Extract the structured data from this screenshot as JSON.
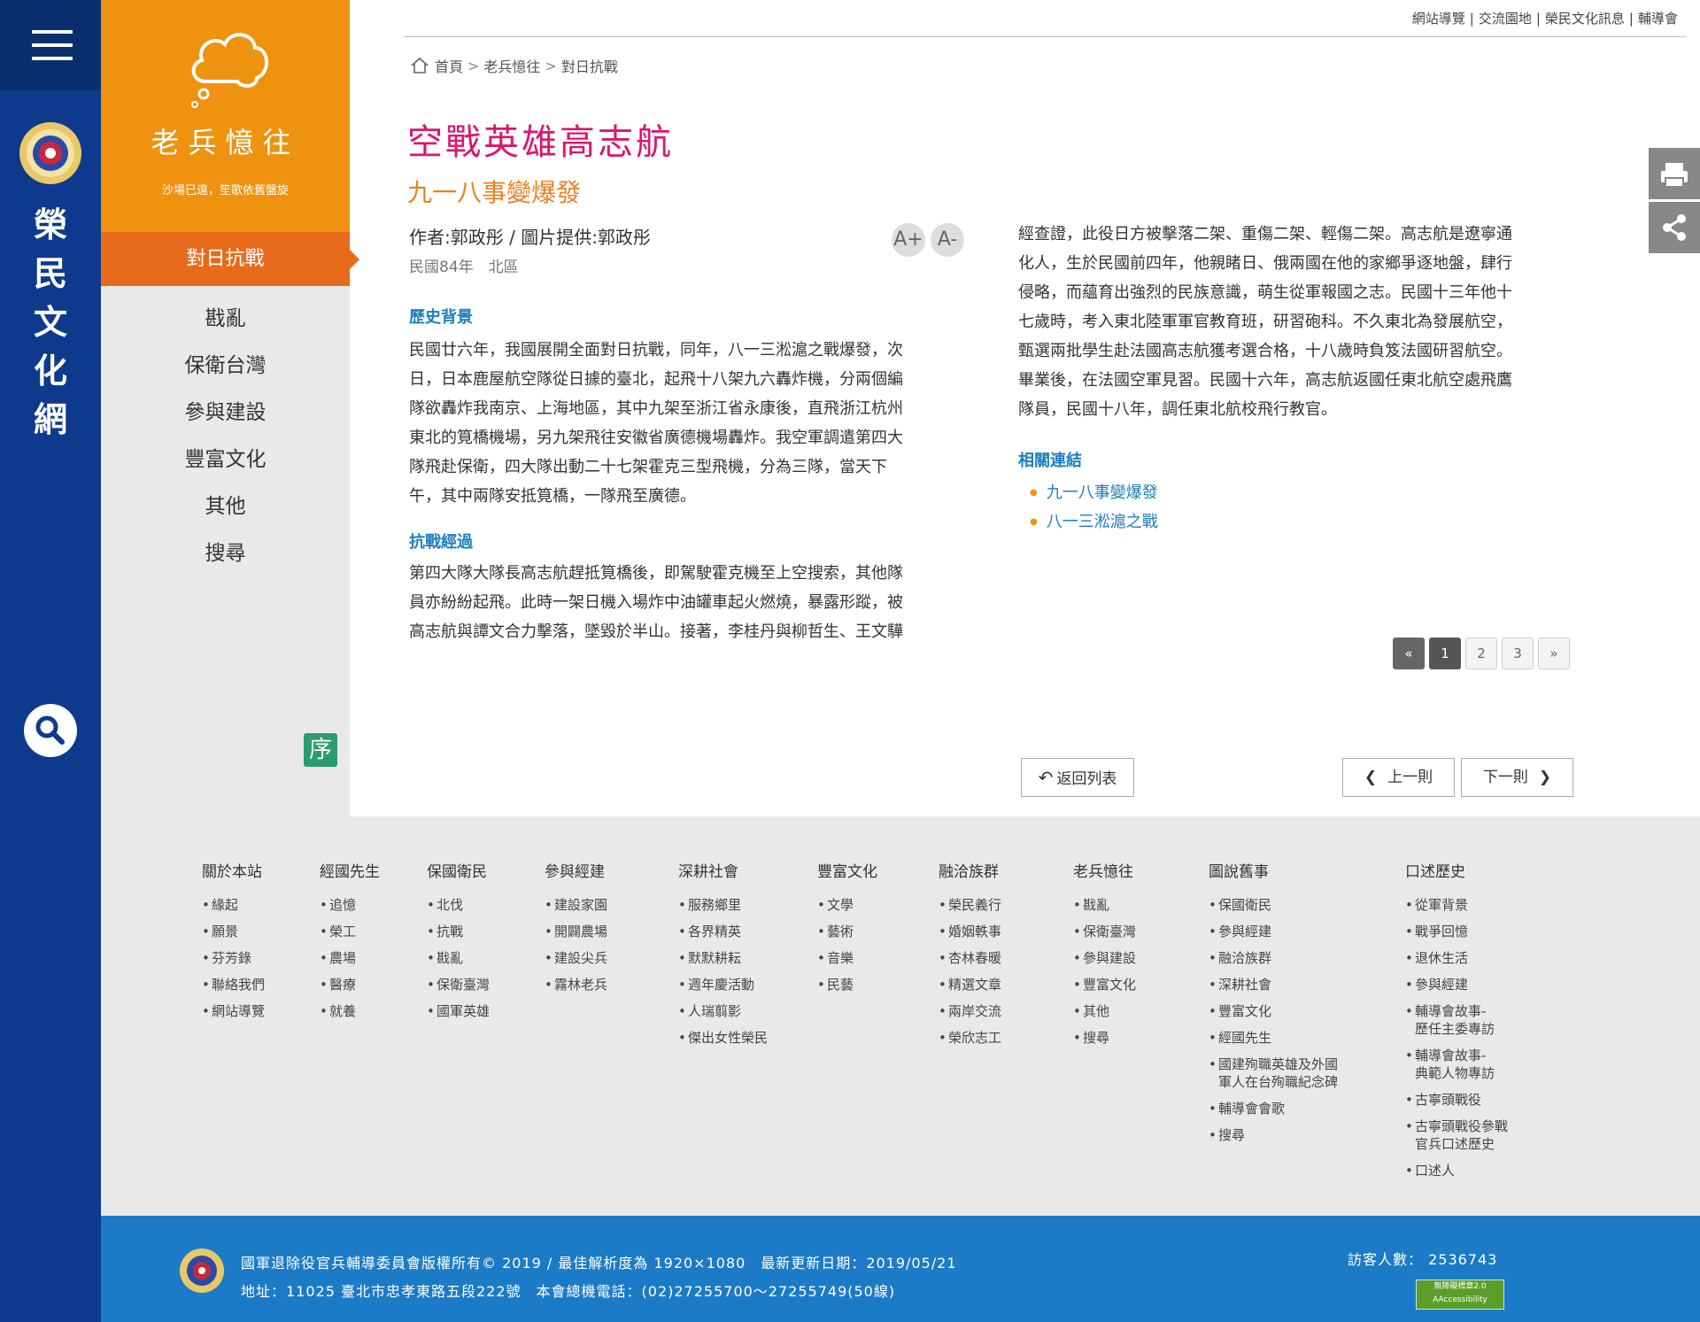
{
  "site": {
    "name_chars": [
      "榮",
      "民",
      "文",
      "化",
      "網"
    ],
    "search_icon": "magnifier-icon"
  },
  "top_links": [
    "網站導覽",
    "交流園地",
    "榮民文化訊息",
    "輔導會"
  ],
  "breadcrumb": [
    "首頁",
    "老兵憶往",
    "對日抗戰"
  ],
  "section": {
    "title": "老兵憶往",
    "subtitle": "沙場已遠，笙歌依舊盤旋",
    "active": "對日抗戰",
    "items": [
      "戡亂",
      "保衛台灣",
      "參與建設",
      "豐富文化",
      "其他",
      "搜尋"
    ],
    "seq_label": "序"
  },
  "article": {
    "title": "空戰英雄高志航",
    "subtitle": "九一八事變爆發",
    "author": "作者:郭政彤 / 圖片提供:郭政彤",
    "meta": "民國84年　北區",
    "font_up": "A+",
    "font_down": "A-",
    "h1": "歷史背景",
    "p1": [
      "民國廿六年，我國展開全面對日抗戰，同年，八一三淞滬之戰爆發，次",
      "日，日本鹿屋航空隊從日據的臺北，起飛十八架九六轟炸機，分兩個編",
      "隊欲轟炸我南京、上海地區，其中九架至浙江省永康後，直飛浙江杭州",
      "東北的筧橋機場，另九架飛往安徽省廣德機場轟炸。我空軍調遣第四大",
      "隊飛赴保衛，四大隊出動二十七架霍克三型飛機，分為三隊，當天下",
      "午，其中兩隊安抵筧橋，一隊飛至廣德。"
    ],
    "h2": "抗戰經過",
    "p2": [
      "第四大隊大隊長高志航趕抵筧橋後，即駕駛霍克機至上空搜索，其他隊",
      "員亦紛紛起飛。此時一架日機入場炸中油罐車起火燃燒，暴露形蹤，被",
      "高志航與譚文合力擊落，墜毀於半山。接著，李桂丹與柳哲生、王文驊"
    ],
    "p3": [
      "經查證，此役日方被擊落二架、重傷二架、輕傷二架。高志航是遼寧通",
      "化人，生於民國前四年，他親睹日、俄兩國在他的家鄉爭逐地盤，肆行",
      "侵略，而蘊育出強烈的民族意識，萌生從軍報國之志。民國十三年他十",
      "七歲時，考入東北陸軍軍官教育班，研習砲科。不久東北為發展航空，",
      "甄選兩批學生赴法國高志航獲考選合格，十八歲時負笈法國研習航空。",
      "畢業後，在法國空軍見習。民國十六年，高志航返國任東北航空處飛鷹",
      "隊員，民國十八年，調任東北航校飛行教官。"
    ],
    "related_title": "相關連結",
    "related": [
      "九一八事變爆發",
      "八一三淞滬之戰"
    ]
  },
  "pagination": {
    "first": "«",
    "pages": [
      "1",
      "2",
      "3"
    ],
    "current": "1",
    "last": "»"
  },
  "nav_buttons": {
    "back": "返回列表",
    "prev": "上一則",
    "next": "下一則"
  },
  "footer_cols": [
    {
      "title": "關於本站",
      "items": [
        "緣起",
        "願景",
        "芬芳錄",
        "聯絡我們",
        "網站導覽"
      ]
    },
    {
      "title": "經國先生",
      "items": [
        "追憶",
        "榮工",
        "農場",
        "醫療",
        "就養"
      ]
    },
    {
      "title": "保國衛民",
      "items": [
        "北伐",
        "抗戰",
        "戡亂",
        "保衛臺灣",
        "國軍英雄"
      ]
    },
    {
      "title": "參與經建",
      "items": [
        "建設家園",
        "開闢農場",
        "建設尖兵",
        "霧林老兵"
      ]
    },
    {
      "title": "深耕社會",
      "items": [
        "服務鄉里",
        "各界精英",
        "默默耕耘",
        "週年慶活動",
        "人瑞翦影",
        "傑出女性榮民"
      ]
    },
    {
      "title": "豐富文化",
      "items": [
        "文學",
        "藝術",
        "音樂",
        "民藝"
      ]
    },
    {
      "title": "融洽族群",
      "items": [
        "榮民義行",
        "婚姻軼事",
        "杏林春暖",
        "精選文章",
        "兩岸交流",
        "榮欣志工"
      ]
    },
    {
      "title": "老兵憶往",
      "items": [
        "戡亂",
        "保衛臺灣",
        "參與建設",
        "豐富文化",
        "其他",
        "搜尋"
      ]
    },
    {
      "title": "圖說舊事",
      "items": [
        "保國衛民",
        "參與經建",
        "融洽族群",
        "深耕社會",
        "豐富文化",
        "經國先生",
        "國建殉職英雄及外國\n軍人在台殉職紀念碑",
        "輔導會會歌",
        "搜尋"
      ]
    },
    {
      "title": "口述歷史",
      "items": [
        "從軍背景",
        "戰爭回憶",
        "退休生活",
        "參與經建",
        "輔導會故事-\n歷任主委專訪",
        "輔導會故事-\n典範人物專訪",
        "古寧頭戰役",
        "古寧頭戰役參戰\n官兵口述歷史",
        "口述人"
      ]
    }
  ],
  "bottom": {
    "line1": "國軍退除役官兵輔導委員會版權所有© 2019 / 最佳解析度為 1920×1080　最新更新日期：2019/05/21",
    "line2": "地址：11025 臺北市忠孝東路五段222號　本會總機電話：(02)27255700～27255749(50線)",
    "visitors": "訪客人數： 2536743",
    "acc_badge": "無障礙標章2.0 AAccessibility"
  },
  "colors": {
    "navy": "#0d3a8c",
    "orange": "#ef920f",
    "active": "#e86b1c",
    "title": "#d9166f",
    "link": "#1b7fbf"
  }
}
